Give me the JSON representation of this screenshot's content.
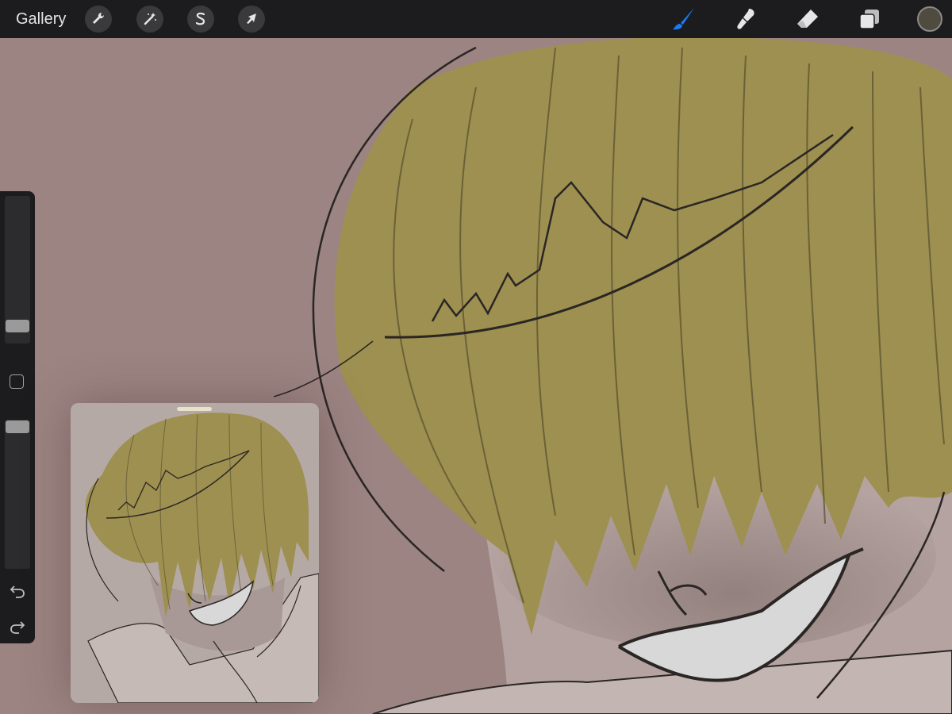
{
  "toolbar": {
    "gallery_label": "Gallery",
    "left_tools": [
      {
        "name": "actions",
        "icon": "wrench-icon"
      },
      {
        "name": "adjustments",
        "icon": "magic-wand-icon"
      },
      {
        "name": "selection",
        "icon": "selection-s-icon"
      },
      {
        "name": "transform",
        "icon": "arrow-cursor-icon"
      }
    ],
    "right_tools": [
      {
        "name": "brush",
        "icon": "brush-icon",
        "active": true
      },
      {
        "name": "smudge",
        "icon": "smudge-icon",
        "active": false
      },
      {
        "name": "eraser",
        "icon": "eraser-icon",
        "active": false
      },
      {
        "name": "layers",
        "icon": "layers-icon",
        "active": false
      }
    ],
    "current_color": "#4f4b3f",
    "active_tool_color": "#1a7bf2"
  },
  "sidebar": {
    "brush_size_level": 0.08,
    "brush_opacity_level": 0.0,
    "modify_button_icon": "square-icon",
    "undo_icon": "undo-arrow-icon",
    "redo_icon": "redo-arrow-icon"
  },
  "canvas": {
    "background_color": "#9c8482",
    "hair_color": "#9e9050",
    "skin_color": "#b4a3a0",
    "line_color": "#2a2624"
  }
}
